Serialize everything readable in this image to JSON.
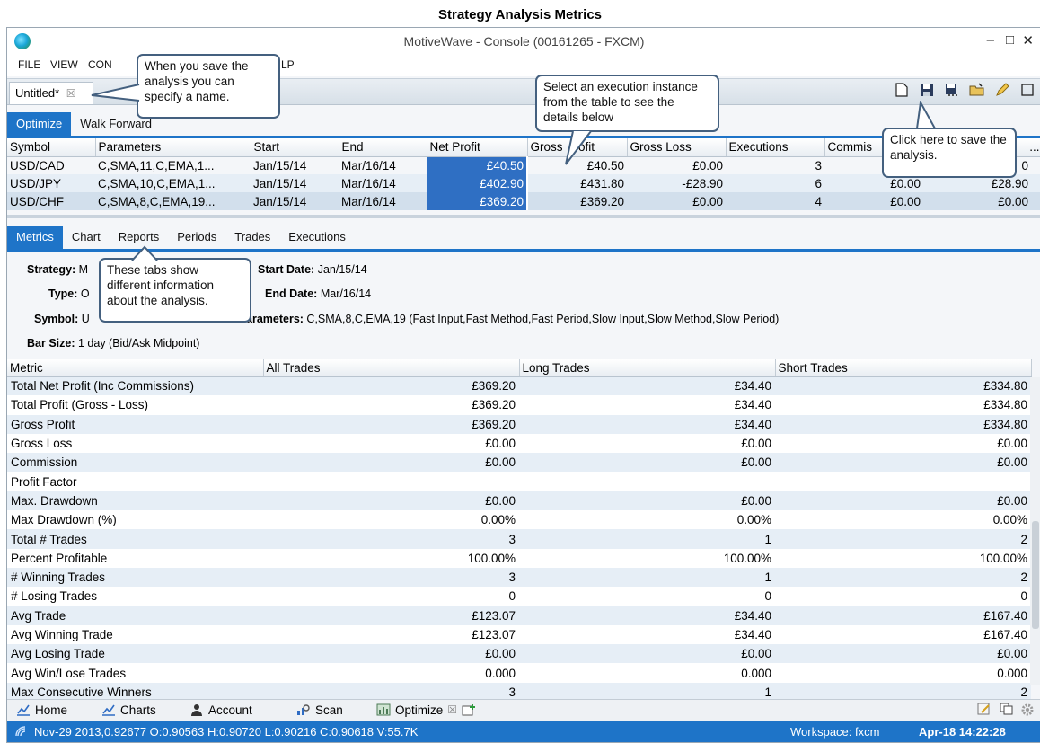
{
  "doc_title": "Strategy Analysis Metrics",
  "window": {
    "title": "MotiveWave - Console (00161265 - FXCM)",
    "controls": {
      "minimize": "–",
      "maximize": "□",
      "close": "✕"
    }
  },
  "menu": [
    "FILE",
    "VIEW",
    "CON",
    "LP"
  ],
  "doc_tab": {
    "label": "Untitled*",
    "close": "☒"
  },
  "toolbar": {
    "icons": [
      "new-doc-icon",
      "save-icon",
      "save-as-icon",
      "open-folder-icon",
      "edit-pencil-icon",
      "restore-icon"
    ]
  },
  "optimize_tabs": [
    "Optimize",
    "Walk Forward"
  ],
  "executions_table": {
    "headers": [
      "Symbol",
      "Parameters",
      "Start",
      "End",
      "Net Profit",
      "Gross",
      "rofit",
      "Gross Loss",
      "Executions",
      "Commis",
      "..."
    ],
    "rows": [
      {
        "symbol": "USD/CAD",
        "parameters": "C,SMA,11,C,EMA,1...",
        "start": "Jan/15/14",
        "end": "Mar/16/14",
        "net_profit": "£40.50",
        "gross_profit": "£40.50",
        "gross_loss": "£0.00",
        "executions": "3",
        "commission": "",
        "last": "0"
      },
      {
        "symbol": "USD/JPY",
        "parameters": "C,SMA,10,C,EMA,1...",
        "start": "Jan/15/14",
        "end": "Mar/16/14",
        "net_profit": "£402.90",
        "gross_profit": "£431.80",
        "gross_loss": "-£28.90",
        "executions": "6",
        "commission": "£0.00",
        "last": "£28.90"
      },
      {
        "symbol": "USD/CHF",
        "parameters": "C,SMA,8,C,EMA,19...",
        "start": "Jan/15/14",
        "end": "Mar/16/14",
        "net_profit": "£369.20",
        "gross_profit": "£369.20",
        "gross_loss": "£0.00",
        "executions": "4",
        "commission": "£0.00",
        "last": "£0.00"
      }
    ]
  },
  "metric_tabs": [
    "Metrics",
    "Chart",
    "Reports",
    "Periods",
    "Trades",
    "Executions"
  ],
  "info": {
    "strategy_label": "Strategy:",
    "strategy_value": "M",
    "type_label": "Type:",
    "type_value": "O",
    "symbol_label": "Symbol:",
    "symbol_value": "U",
    "bar_size_label": "Bar Size:",
    "bar_size_value": "1 day (Bid/Ask Midpoint)",
    "start_date_label": "Start Date:",
    "start_date_value": "Jan/15/14",
    "end_date_label": "End Date:",
    "end_date_value": "Mar/16/14",
    "parameters_label": "arameters:",
    "parameters_value": "C,SMA,8,C,EMA,19 (Fast Input,Fast Method,Fast Period,Slow Input,Slow Method,Slow Period)"
  },
  "metrics_table": {
    "headers": [
      "Metric",
      "All Trades",
      "Long Trades",
      "Short Trades"
    ],
    "rows": [
      [
        "Total Net Profit (Inc Commissions)",
        "£369.20",
        "£34.40",
        "£334.80"
      ],
      [
        "Total Profit (Gross - Loss)",
        "£369.20",
        "£34.40",
        "£334.80"
      ],
      [
        "Gross Profit",
        "£369.20",
        "£34.40",
        "£334.80"
      ],
      [
        "Gross Loss",
        "£0.00",
        "£0.00",
        "£0.00"
      ],
      [
        "Commission",
        "£0.00",
        "£0.00",
        "£0.00"
      ],
      [
        "Profit Factor",
        "",
        "",
        ""
      ],
      [
        "Max. Drawdown",
        "£0.00",
        "£0.00",
        "£0.00"
      ],
      [
        "Max Drawdown (%)",
        "0.00%",
        "0.00%",
        "0.00%"
      ],
      [
        "Total # Trades",
        "3",
        "1",
        "2"
      ],
      [
        "Percent Profitable",
        "100.00%",
        "100.00%",
        "100.00%"
      ],
      [
        "# Winning Trades",
        "3",
        "1",
        "2"
      ],
      [
        "# Losing Trades",
        "0",
        "0",
        "0"
      ],
      [
        "Avg Trade",
        "£123.07",
        "£34.40",
        "£167.40"
      ],
      [
        "Avg Winning Trade",
        "£123.07",
        "£34.40",
        "£167.40"
      ],
      [
        "Avg Losing Trade",
        "£0.00",
        "£0.00",
        "£0.00"
      ],
      [
        "Avg Win/Lose Trades",
        "0.000",
        "0.000",
        "0.000"
      ],
      [
        "Max Consecutive Winners",
        "3",
        "1",
        "2"
      ]
    ]
  },
  "dock": {
    "items": [
      "Home",
      "Charts",
      "Account",
      "Scan",
      "Optimize"
    ],
    "optimize_close": "☒"
  },
  "status": {
    "left": "Nov-29 2013,0.92677 O:0.90563 H:0.90720 L:0.90216 C:0.90618 V:55.7K",
    "workspace": "Workspace: fxcm",
    "datetime": "Apr-18 14:22:28"
  },
  "callouts": {
    "save_name": "When you save the analysis you can specify a name.",
    "select_exec": "Select an execution instance from the table to see the details below",
    "save_click": "Click here to save the analysis.",
    "tabs_info": "These tabs show different information about the analysis."
  },
  "colors": {
    "accent": "#1e74c8",
    "selected_cell": "#2f6fc3",
    "callout_border": "#44607f"
  }
}
